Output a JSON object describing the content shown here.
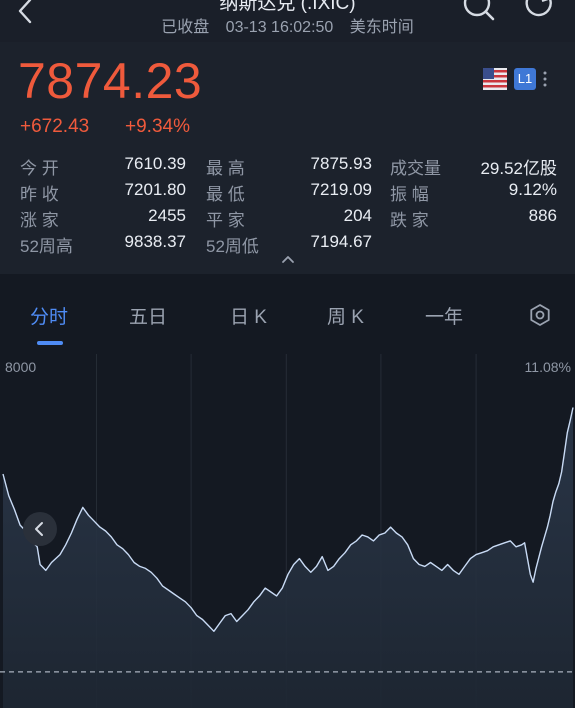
{
  "header": {
    "title": "纳斯达克 (.IXIC)",
    "status": "已收盘",
    "datetime": "03-13 16:02:50",
    "timezone": "美东时间"
  },
  "quote": {
    "price": "7874.23",
    "change": "+672.43",
    "change_pct": "+9.34%",
    "level_badge": "L1",
    "colors": {
      "up": "#ef5a3c",
      "accent": "#4f8cf5"
    },
    "stats": [
      {
        "label": "今 开",
        "value": "7610.39"
      },
      {
        "label": "最 高",
        "value": "7875.93"
      },
      {
        "label": "成交量",
        "value": "29.52亿股"
      },
      {
        "label": "昨 收",
        "value": "7201.80"
      },
      {
        "label": "最 低",
        "value": "7219.09"
      },
      {
        "label": "振 幅",
        "value": "9.12%"
      },
      {
        "label": "涨 家",
        "value": "2455"
      },
      {
        "label": "平 家",
        "value": "204"
      },
      {
        "label": "跌 家",
        "value": "886"
      },
      {
        "label": "52周高",
        "value": "9838.37"
      },
      {
        "label": "52周低",
        "value": "7194.67"
      }
    ]
  },
  "tabs": [
    {
      "label": "分时",
      "active": true
    },
    {
      "label": "五日",
      "active": false
    },
    {
      "label": "日 K",
      "active": false
    },
    {
      "label": "周 K",
      "active": false
    },
    {
      "label": "一年",
      "active": false
    }
  ],
  "icons": [
    "back-icon",
    "search-icon",
    "refresh-icon",
    "flag-icon",
    "more-icon",
    "expand-icon",
    "settings-icon",
    "collapse-left-icon"
  ],
  "chart_data": {
    "type": "line",
    "y_top_label": "8000",
    "pct_top_label": "11.08%",
    "y_at_top": 8000,
    "y_reference": 7201.8,
    "ylim": [
      7110,
      8000
    ],
    "x_range": [
      0,
      1
    ],
    "grid": "vertical",
    "series": [
      {
        "values": [
          [
            0.0,
            7705
          ],
          [
            0.01,
            7650
          ],
          [
            0.02,
            7615
          ],
          [
            0.03,
            7575
          ],
          [
            0.04,
            7560
          ],
          [
            0.05,
            7535
          ],
          [
            0.06,
            7520
          ],
          [
            0.065,
            7475
          ],
          [
            0.075,
            7460
          ],
          [
            0.085,
            7480
          ],
          [
            0.1,
            7500
          ],
          [
            0.11,
            7525
          ],
          [
            0.12,
            7555
          ],
          [
            0.13,
            7590
          ],
          [
            0.14,
            7620
          ],
          [
            0.15,
            7600
          ],
          [
            0.16,
            7585
          ],
          [
            0.17,
            7570
          ],
          [
            0.18,
            7560
          ],
          [
            0.19,
            7545
          ],
          [
            0.2,
            7525
          ],
          [
            0.21,
            7515
          ],
          [
            0.22,
            7500
          ],
          [
            0.23,
            7480
          ],
          [
            0.24,
            7470
          ],
          [
            0.25,
            7465
          ],
          [
            0.26,
            7455
          ],
          [
            0.27,
            7440
          ],
          [
            0.28,
            7420
          ],
          [
            0.29,
            7410
          ],
          [
            0.3,
            7400
          ],
          [
            0.31,
            7390
          ],
          [
            0.32,
            7380
          ],
          [
            0.33,
            7365
          ],
          [
            0.34,
            7345
          ],
          [
            0.35,
            7335
          ],
          [
            0.36,
            7320
          ],
          [
            0.37,
            7305
          ],
          [
            0.38,
            7325
          ],
          [
            0.39,
            7345
          ],
          [
            0.4,
            7350
          ],
          [
            0.41,
            7330
          ],
          [
            0.42,
            7345
          ],
          [
            0.43,
            7360
          ],
          [
            0.44,
            7380
          ],
          [
            0.45,
            7395
          ],
          [
            0.46,
            7415
          ],
          [
            0.47,
            7405
          ],
          [
            0.48,
            7395
          ],
          [
            0.49,
            7415
          ],
          [
            0.5,
            7450
          ],
          [
            0.51,
            7475
          ],
          [
            0.52,
            7490
          ],
          [
            0.53,
            7470
          ],
          [
            0.54,
            7455
          ],
          [
            0.55,
            7470
          ],
          [
            0.56,
            7495
          ],
          [
            0.57,
            7460
          ],
          [
            0.58,
            7470
          ],
          [
            0.59,
            7490
          ],
          [
            0.6,
            7505
          ],
          [
            0.61,
            7525
          ],
          [
            0.62,
            7535
          ],
          [
            0.63,
            7550
          ],
          [
            0.64,
            7545
          ],
          [
            0.65,
            7535
          ],
          [
            0.66,
            7550
          ],
          [
            0.67,
            7555
          ],
          [
            0.68,
            7570
          ],
          [
            0.69,
            7555
          ],
          [
            0.7,
            7545
          ],
          [
            0.71,
            7525
          ],
          [
            0.72,
            7490
          ],
          [
            0.73,
            7475
          ],
          [
            0.74,
            7470
          ],
          [
            0.75,
            7480
          ],
          [
            0.76,
            7470
          ],
          [
            0.77,
            7460
          ],
          [
            0.78,
            7475
          ],
          [
            0.79,
            7460
          ],
          [
            0.8,
            7450
          ],
          [
            0.81,
            7470
          ],
          [
            0.82,
            7490
          ],
          [
            0.83,
            7500
          ],
          [
            0.84,
            7505
          ],
          [
            0.85,
            7510
          ],
          [
            0.86,
            7520
          ],
          [
            0.87,
            7525
          ],
          [
            0.88,
            7530
          ],
          [
            0.89,
            7535
          ],
          [
            0.9,
            7520
          ],
          [
            0.91,
            7525
          ],
          [
            0.915,
            7530
          ],
          [
            0.925,
            7450
          ],
          [
            0.93,
            7430
          ],
          [
            0.935,
            7465
          ],
          [
            0.945,
            7520
          ],
          [
            0.95,
            7545
          ],
          [
            0.955,
            7570
          ],
          [
            0.96,
            7600
          ],
          [
            0.965,
            7635
          ],
          [
            0.97,
            7660
          ],
          [
            0.975,
            7680
          ],
          [
            0.98,
            7710
          ],
          [
            0.985,
            7760
          ],
          [
            0.99,
            7810
          ],
          [
            0.995,
            7840
          ],
          [
            1.0,
            7874.23
          ]
        ]
      }
    ]
  }
}
